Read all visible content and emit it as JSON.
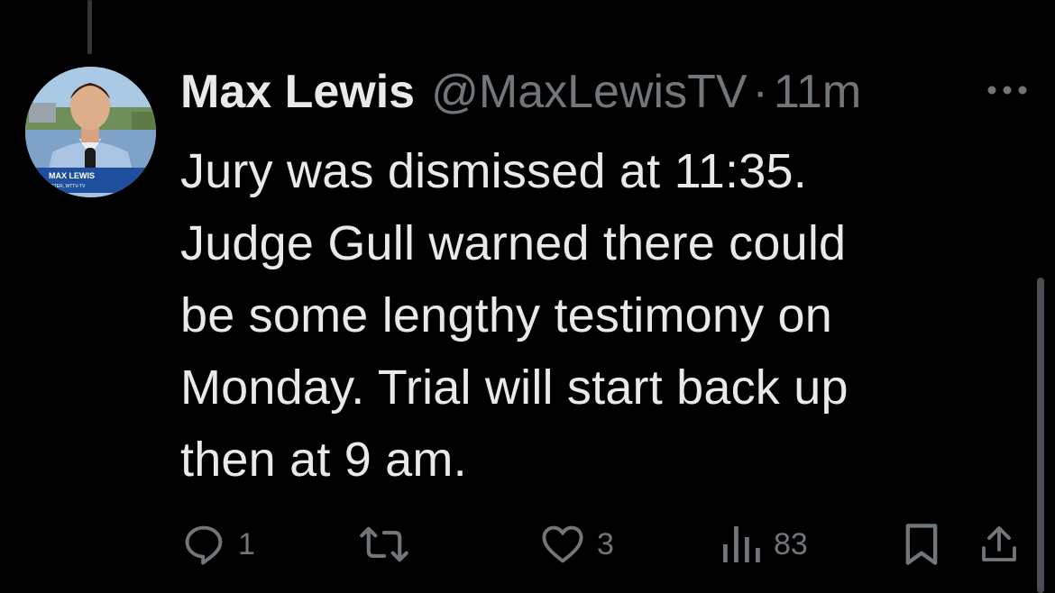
{
  "tweet": {
    "display_name": "Max Lewis",
    "handle": "@MaxLewisTV",
    "separator": "·",
    "time": "11m",
    "text": "Jury was dismissed at 11:35.\nJudge Gull warned there could\nbe some lengthy testimony on\nMonday. Trial will start back up\nthen at 9 am."
  },
  "avatar": {
    "lower_third_name": "MAX LEWIS",
    "lower_third_title": "REPORTER, WTTV-TV"
  },
  "actions": {
    "reply_count": "1",
    "retweet_count": "",
    "like_count": "3",
    "views_count": "83"
  },
  "icons": {
    "more": "more-horizontal-icon",
    "reply": "reply-icon",
    "retweet": "retweet-icon",
    "like": "heart-icon",
    "views": "views-icon",
    "bookmark": "bookmark-icon",
    "share": "share-icon"
  },
  "colors": {
    "background": "#000000",
    "primary_text": "#e7e9ea",
    "secondary_text": "#71767b"
  }
}
